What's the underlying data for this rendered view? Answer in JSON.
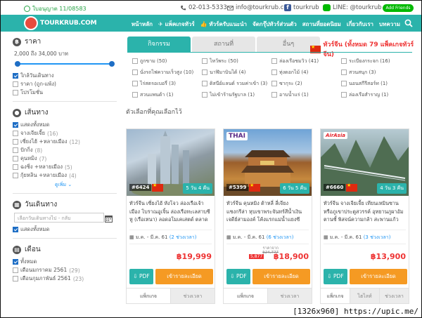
{
  "topbar": {
    "license": "ใบอนุญาต 11/08583",
    "phone": "02-013-5333",
    "email": "info@tourkrub.co",
    "facebook": "tourkrub",
    "line": "LINE: @tourkrub",
    "add_friends": "Add Friends"
  },
  "nav": {
    "logo": "TOURKRUB.COM",
    "items": [
      "หน้าหลัก",
      "แพ็คเกจทัวร์",
      "ทัวร์ครับแนะนำ",
      "จัดกรุ๊ปทัวร์ส่วนตัว",
      "สถานที่ยอดนิยม",
      "เกี่ยวกับเรา",
      "บทความ"
    ]
  },
  "sidebar": {
    "price": {
      "heading": "ราคา",
      "range": "2,000 ถึง 34,000 บาท",
      "options": [
        {
          "label": "ใกล้วันเดินทาง",
          "checked": true
        },
        {
          "label": "ราคา (ถูก-แพ้ง)",
          "checked": false
        },
        {
          "label": "โปรโมชั่น",
          "checked": false
        }
      ]
    },
    "route": {
      "heading": "เส้นทาง",
      "options": [
        {
          "label": "แสดงทั้งหมด",
          "count": "",
          "checked": true
        },
        {
          "label": "จางเจียเจี้ย",
          "count": "(16)",
          "checked": false
        },
        {
          "label": "เซี่ยงไฮ้ +หลายเมือง",
          "count": "(12)",
          "checked": false
        },
        {
          "label": "ปักกิ่ง",
          "count": "(8)",
          "checked": false
        },
        {
          "label": "คุนหมิง",
          "count": "(7)",
          "checked": false
        },
        {
          "label": "ฉงชิ่ง +หลายเมือง",
          "count": "(5)",
          "checked": false
        },
        {
          "label": "กุ้ยหลิน +หลายเมือง",
          "count": "(4)",
          "checked": false
        }
      ],
      "more": "ดูเพิ่ม"
    },
    "date": {
      "heading": "วันเดินทาง",
      "placeholder": "เลือกวันเดินทางไป - กลับ",
      "show_all": "แสดงทั้งหมด"
    },
    "month": {
      "heading": "เดือน",
      "options": [
        {
          "label": "ทั้งหมด",
          "count": "",
          "checked": true
        },
        {
          "label": "เดือนมกราคม 2561",
          "count": "(29)",
          "checked": false
        },
        {
          "label": "เดือนกุมภาพันธ์ 2561",
          "count": "(23)",
          "checked": false
        }
      ]
    }
  },
  "tabs": [
    "กิจกรรม",
    "สถานที่",
    "อื่นๆ"
  ],
  "main_title": "ทัวร์จีน (ทั้งหมด 79 แพ็คเกจทัวร์จีน)",
  "filters": [
    {
      "label": "ถูกขาม (50)"
    },
    {
      "label": "ไหว้พระ (50)"
    },
    {
      "label": "ล่องเรือชมวิว (41)"
    },
    {
      "label": "ระเบียงกระจก (16)"
    },
    {
      "label": "นั่งรถไฟความเร็วสูง (10)"
    },
    {
      "label": "นาฬิมาบินได้ (4)"
    },
    {
      "label": "ทุ่งดอกไม้ (4)"
    },
    {
      "label": "สวนสนุก (3)"
    },
    {
      "label": "ไร่สตรอเบอรี่ (3)"
    },
    {
      "label": "ดิสนีย์แลนด์ รวมค่าเข้า (3)"
    },
    {
      "label": "ซากุระ (2)"
    },
    {
      "label": "นอนสกีรีสอร์ท (1)"
    },
    {
      "label": "สวนแพนด้า (1)"
    },
    {
      "label": "ไม่เข้าร้านรัฐบาล (1)"
    },
    {
      "label": "อาบน้ำแร่ (1)"
    },
    {
      "label": "ล่องเรือสำราญ (1)"
    }
  ],
  "selected_title": "ตัวเลือกที่คุณเลือกไว้",
  "cards": [
    {
      "code": "#6424",
      "days": "5 วัน 4 คืน",
      "airline": "",
      "desc": "ทัวร์จีน เซี่ยงไฮ้ หังโจว ล่องเรือเจ้าเมือง โบราณอูเจิ้น ล่องเรือทะเลสาบซีหู (เรือเหนา) ลอดอโมเคเสตด์ ตลาดเฉิงห...",
      "date_label": "ม.ค. - มี.ค. 61",
      "date_link": "(2 ช่วงเวลา)",
      "price_from": "",
      "price_old": "",
      "sale": "",
      "price": "฿19,999",
      "pdf": "PDF",
      "detail": "เข้ารายละเอียด",
      "tab1": "แพ็กเกจ",
      "tab2": "ช่วงเวลา"
    },
    {
      "code": "#5399",
      "days": "6 วัน 5 คืน",
      "airline": "THAI",
      "desc": "ทัวร์จีน คุนหมิง ต้าหลี่ ลี่เจียง แชงกรีล่า หุบเขาพระจันทร์สีน้ำเงิน เจดีย์สามองค์ โค้งแรกแม่น้ำแยงซีเกียง วัดลามะซงจ้...",
      "date_label": "ม.ค. - มี.ค. 61",
      "date_link": "(6 ช่วงเวลา)",
      "price_from": "ราคาจาก",
      "price_old": "฿24,777",
      "sale": "5,877",
      "price": "฿18,900",
      "pdf": "PDF",
      "detail": "เข้ารายละเอียด",
      "tab1": "แพ็กเกจ",
      "tab2": "ช่วงเวลา"
    },
    {
      "code": "#6660",
      "days": "4 วัน 3 คืน",
      "airline": "AirAsia",
      "desc": "ทัวร์จีน จางเจียเจี้ย เทียนเหมินซาน หรือภูเขาประตูสวรรค์ อุทยานภูผาอัมตานชั้ พิสจน์ความกล้า สะพานแก้ว ฟักโรง...",
      "date_label": "ม.ค. - มี.ค. 61",
      "date_link": "(3 ช่วงเวลา)",
      "price_from": "",
      "price_old": "",
      "sale": "",
      "price": "฿13,900",
      "pdf": "PDF",
      "detail": "เข้ารายละเอียด",
      "tab1": "แพ็กเกจ",
      "tab2": "ไฮไลท์",
      "tab3": "ช่วงเวลา"
    }
  ],
  "caption": "[1326x960] https://upic.me/",
  "colors": {
    "teal": "#2bb3ab",
    "orange": "#f59a23",
    "price_red": "#ee3333",
    "blue": "#1e6ec5"
  }
}
